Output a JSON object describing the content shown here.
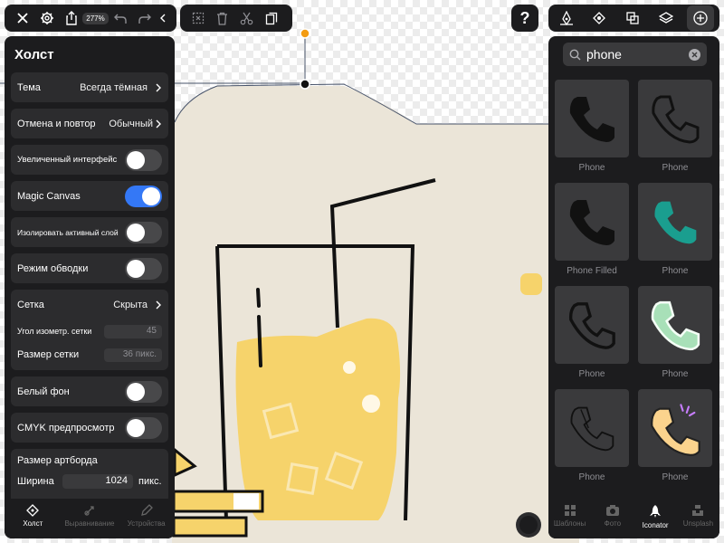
{
  "toolbar_left": {
    "close_icon": "close-icon",
    "settings_icon": "gear-icon",
    "share_icon": "share-icon",
    "zoom_label": "277%",
    "undo_icon": "undo-icon",
    "redo_icon": "redo-icon",
    "collapse_icon": "chevron-left-icon"
  },
  "toolbar_mid": {
    "icons": [
      "select-box-icon",
      "trash-icon",
      "scissors-icon",
      "duplicate-icon"
    ]
  },
  "help_label": "?",
  "toolbar_right": {
    "icons": [
      "pen-tool-icon",
      "node-icon",
      "boolean-icon",
      "layers-icon",
      "plus-icon"
    ]
  },
  "canvas_panel": {
    "title": "Холст",
    "theme": {
      "label": "Тема",
      "value": "Всегда тёмная"
    },
    "undo_redo": {
      "label": "Отмена и повтор",
      "value": "Обычный"
    },
    "large_ui": {
      "label": "Увеличенный интерфейс",
      "on": false
    },
    "magic_canvas": {
      "label": "Magic Canvas",
      "on": true
    },
    "isolate_layer": {
      "label": "Изолировать активный слой",
      "on": false
    },
    "outline_mode": {
      "label": "Режим обводки",
      "on": false
    },
    "grid": {
      "label": "Сетка",
      "value": "Скрыта",
      "angle_label": "Угол изометр. сетки",
      "angle_value": "45",
      "size_label": "Размер сетки",
      "size_value": "36 пикс."
    },
    "white_bg": {
      "label": "Белый фон",
      "on": false
    },
    "cmyk_preview": {
      "label": "CMYK предпросмотр",
      "on": false
    },
    "artboard": {
      "label": "Размер артборда",
      "width_label": "Ширина",
      "width_value": "1024",
      "width_unit": "пикс."
    },
    "tabs": [
      {
        "label": "Холст",
        "icon": "canvas-icon",
        "active": true
      },
      {
        "label": "Выравнивание",
        "icon": "align-icon",
        "active": false
      },
      {
        "label": "Устройства",
        "icon": "pencil-icon",
        "active": false
      }
    ]
  },
  "icon_panel": {
    "search_value": "phone",
    "results": [
      {
        "label": "Phone",
        "style": "filled-black"
      },
      {
        "label": "Phone",
        "style": "outline-black"
      },
      {
        "label": "Phone Filled",
        "style": "filled-black"
      },
      {
        "label": "Phone",
        "style": "filled-teal"
      },
      {
        "label": "Phone",
        "style": "outline-thin"
      },
      {
        "label": "Phone",
        "style": "filled-mint"
      },
      {
        "label": "Phone",
        "style": "outline-dark"
      },
      {
        "label": "Phone",
        "style": "ringing-color"
      }
    ],
    "tabs": [
      {
        "label": "Шаблоны",
        "icon": "templates-icon",
        "active": false
      },
      {
        "label": "Фото",
        "icon": "camera-icon",
        "active": false
      },
      {
        "label": "Iconator",
        "icon": "rocket-icon",
        "active": true
      },
      {
        "label": "Unsplash",
        "icon": "unsplash-icon",
        "active": false
      }
    ]
  },
  "colors": {
    "panel_bg": "#1c1c1e",
    "accent": "#3478f6",
    "drink_yellow": "#f6d36b",
    "canvas_cream": "#ebe5d8",
    "teal": "#1a9e8f",
    "mint": "#a8e0b8"
  }
}
